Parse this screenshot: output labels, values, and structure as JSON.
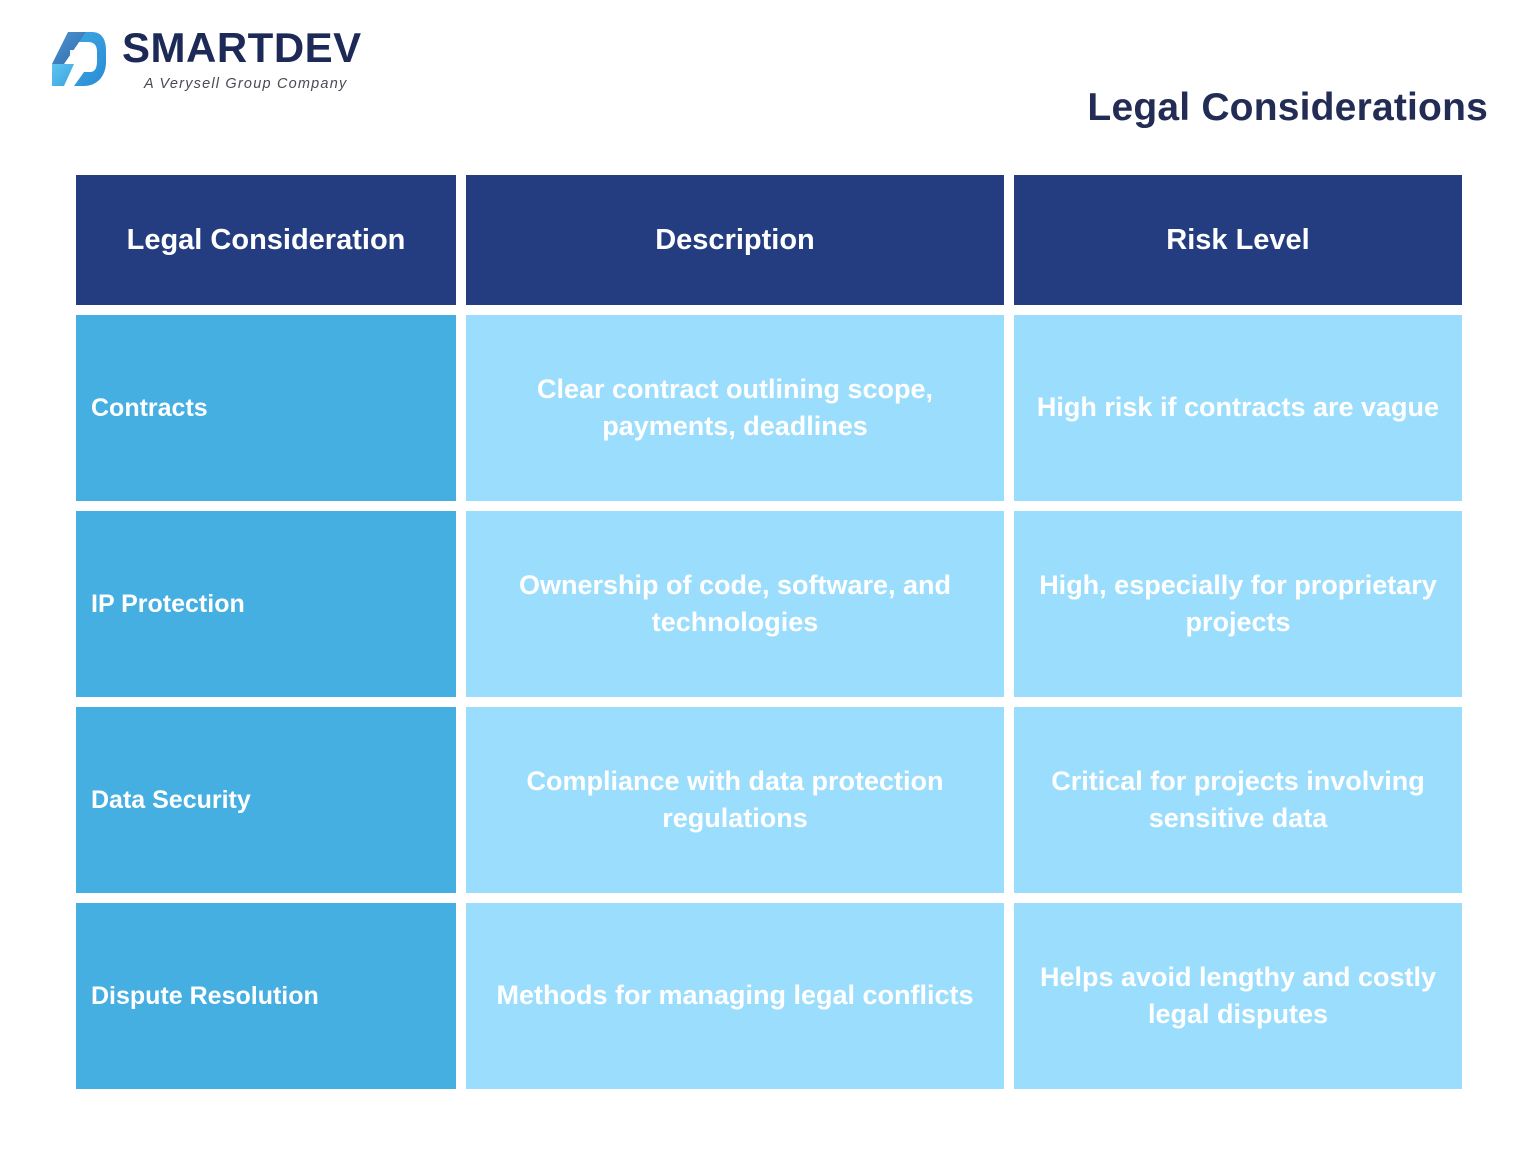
{
  "brand": {
    "logo_icon": "smartdev-d-logo",
    "name": "SMARTDEV",
    "tagline": "A Verysell Group Company"
  },
  "page": {
    "title": "Legal Considerations"
  },
  "colors": {
    "header_navy": "#243d81",
    "title_navy": "#232c54",
    "label_blue": "#45afe2",
    "detail_blue": "#9bddfd",
    "text_white": "#ffffff",
    "background": "#ffffff"
  },
  "table": {
    "columns": [
      {
        "header": "Legal Consideration"
      },
      {
        "header": "Description"
      },
      {
        "header": "Risk Level"
      }
    ],
    "rows": [
      {
        "consideration": "Contracts",
        "description": "Clear contract outlining scope, payments, deadlines",
        "risk_level": "High risk if contracts are vague"
      },
      {
        "consideration": "IP Protection",
        "description": "Ownership of code, software, and technologies",
        "risk_level": "High, especially for proprietary projects"
      },
      {
        "consideration": "Data Security",
        "description": "Compliance with data protection regulations",
        "risk_level": "Critical for projects involving sensitive data"
      },
      {
        "consideration": "Dispute Resolution",
        "description": "Methods for managing legal conflicts",
        "risk_level": "Helps avoid lengthy and costly legal disputes"
      }
    ]
  }
}
